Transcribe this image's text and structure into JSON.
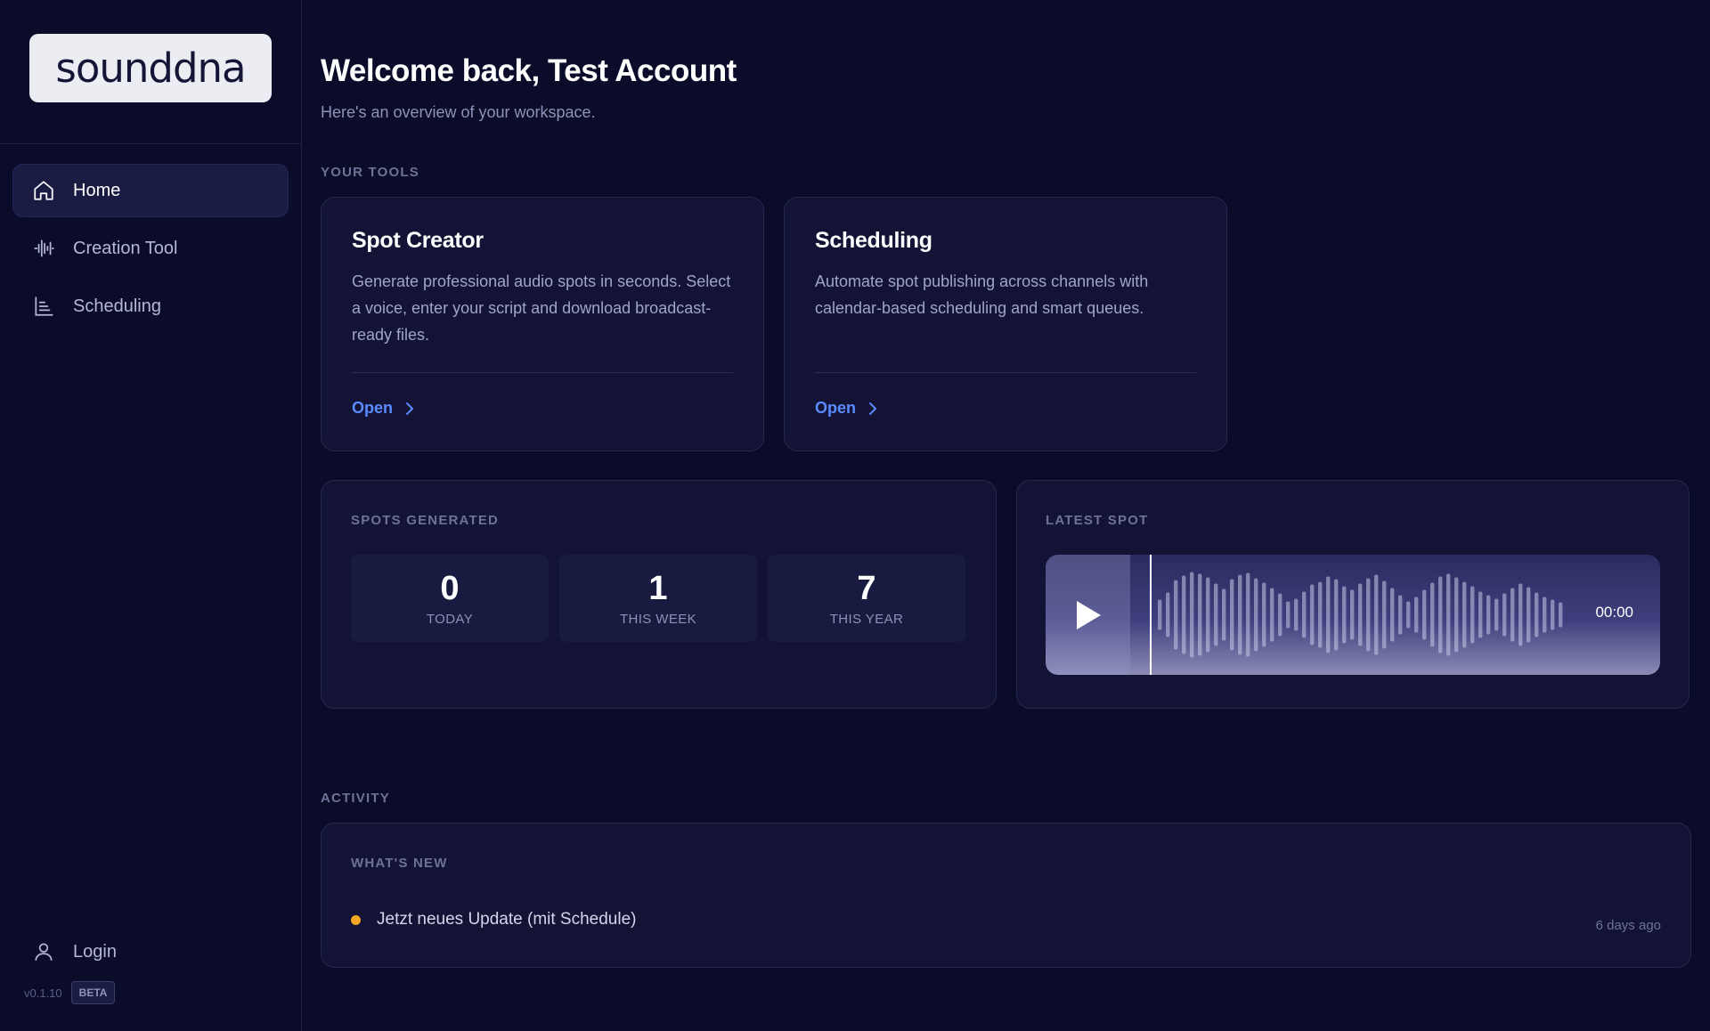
{
  "brand": {
    "logo_text": "sounddna"
  },
  "sidebar": {
    "items": [
      {
        "label": "Home",
        "icon": "home-icon",
        "active": true
      },
      {
        "label": "Creation Tool",
        "icon": "waveform-icon",
        "active": false
      },
      {
        "label": "Scheduling",
        "icon": "chart-icon",
        "active": false
      }
    ],
    "login_label": "Login",
    "version": "v0.1.10",
    "beta_badge": "BETA"
  },
  "header": {
    "welcome_prefix": "Welcome back, ",
    "user_name": "Test Account",
    "subtitle": "Here's an overview of your workspace."
  },
  "tools": {
    "section_label": "YOUR TOOLS",
    "cards": [
      {
        "title": "Spot Creator",
        "description": "Generate professional audio spots in seconds. Select a voice, enter your script and download broadcast-ready files.",
        "open_label": "Open"
      },
      {
        "title": "Scheduling",
        "description": "Automate spot publishing across channels with calendar-based scheduling and smart queues.",
        "open_label": "Open"
      }
    ]
  },
  "stats": {
    "section_label": "SPOTS GENERATED",
    "items": [
      {
        "value": "0",
        "label": "TODAY"
      },
      {
        "value": "1",
        "label": "THIS WEEK"
      },
      {
        "value": "7",
        "label": "THIS YEAR"
      }
    ]
  },
  "latest_spot": {
    "section_label": "LATEST SPOT",
    "time": "00:00"
  },
  "activity": {
    "section_label": "ACTIVITY",
    "card_title": "WHAT'S NEW",
    "items": [
      {
        "text": "Jetzt neues Update (mit Schedule)",
        "time": "6 days ago"
      }
    ]
  },
  "colors": {
    "background": "#0b0c2a",
    "card": "#121335",
    "accent_link": "#5b8cff",
    "news_dot": "#f5a623"
  }
}
